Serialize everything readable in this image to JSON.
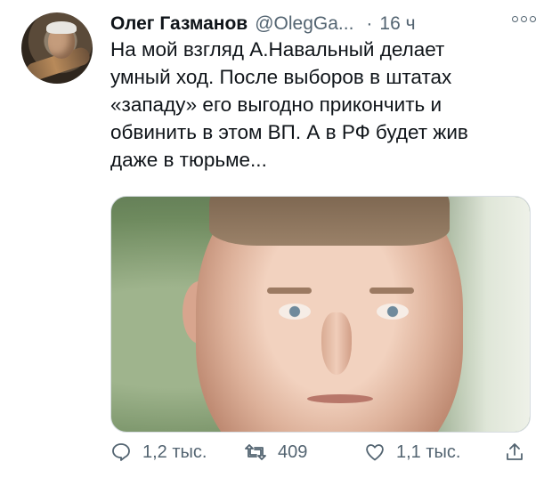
{
  "tweet": {
    "author_name": "Олег Газманов",
    "handle": "@OlegGa...",
    "separator": "·",
    "time": "16 ч",
    "text": "На мой взгляд А.Навальный делает\nумный ход. После выборов в штатах\n«западу» его выгодно прикончить и\nобвинить в этом ВП. А в РФ будет жив\nдаже в тюрьме...",
    "more_icon": "more-icon",
    "avatar_icon": "avatar"
  },
  "actions": {
    "reply": {
      "icon": "reply-icon",
      "count": "1,2 тыс."
    },
    "retweet": {
      "icon": "retweet-icon",
      "count": "409"
    },
    "like": {
      "icon": "like-icon",
      "count": "1,1 тыс."
    },
    "share": {
      "icon": "share-icon"
    }
  },
  "colors": {
    "text_primary": "#0f1419",
    "text_secondary": "#536471",
    "border": "#d7dde2"
  }
}
